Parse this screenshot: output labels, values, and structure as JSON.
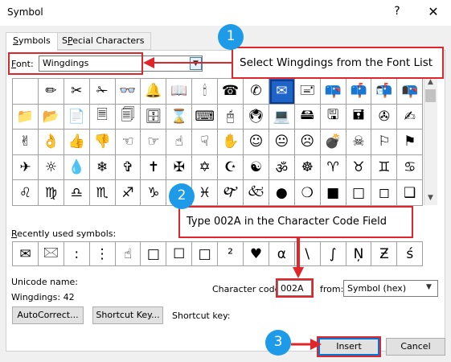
{
  "window": {
    "title": "Symbol",
    "help": "?",
    "close": "✕"
  },
  "tabs": [
    {
      "label": "Symbols",
      "mnemonic": "S",
      "rest": "ymbols"
    },
    {
      "label": "Special Characters",
      "mnemonic": "P",
      "pre": "S",
      "rest": "ecial Characters"
    }
  ],
  "font": {
    "label": "Font:",
    "mnemonic": "F",
    "rest": "ont:",
    "value": "Wingdings"
  },
  "grid": {
    "rows": [
      [
        "",
        "✏",
        "✂",
        "✁",
        "👓",
        "🔔",
        "📖",
        "🕯",
        "☎",
        "✆",
        "✉",
        "🖃",
        "📪",
        "📫",
        "📬",
        "📭"
      ],
      [
        "📁",
        "📂",
        "📄",
        "🗏",
        "🗐",
        "🗄",
        "⌛",
        "⌨",
        "🖰",
        "🖲",
        "💻",
        "🖴",
        "🖫",
        "🖬",
        "✇",
        "✍"
      ],
      [
        "✌",
        "👌",
        "👍",
        "👎",
        "☜",
        "☞",
        "☝",
        "☟",
        "✋",
        "☺",
        "😐",
        "☹",
        "💣",
        "☠",
        "⚐",
        "⚑"
      ],
      [
        "✈",
        "☼",
        "💧",
        "❄",
        "✞",
        "✝",
        "✠",
        "✡",
        "☪",
        "☯",
        "ॐ",
        "☸",
        "♈",
        "♉",
        "♊",
        "♋"
      ],
      [
        "♌",
        "♍",
        "♎",
        "♏",
        "♐",
        "♑",
        "♒",
        "♓",
        "🙰",
        "🙵",
        "●",
        "❍",
        "■",
        "□",
        "◻",
        "❑"
      ]
    ]
  },
  "recent": {
    "label": "Recently used symbols:",
    "mnemonic": "R",
    "rest": "ecently used symbols:",
    "symbols": [
      "✉",
      "🖂",
      ":",
      "⋮",
      "☝",
      "□",
      "☐",
      "□",
      "²",
      "♥",
      "α",
      "\\",
      "∫",
      "Ņ",
      "Ƶ",
      "ś"
    ]
  },
  "unicode": {
    "name_label": "Unicode name:",
    "value": "Wingdings: 42"
  },
  "char_code": {
    "label": "Character code:",
    "value": "002A",
    "from_label": "from:",
    "from_value": "Symbol (hex)"
  },
  "buttons": {
    "autocorrect": "AutoCorrect...",
    "shortcut_key": "Shortcut Key...",
    "insert": "Insert",
    "cancel": "Cancel"
  },
  "shortcut_label": "Shortcut key:",
  "annotations": {
    "step1_num": "1",
    "step1_text": "Select Wingdings from the Font List",
    "step2_num": "2",
    "step2_text": "Type 002A in the Character Code Field",
    "step3_num": "3"
  },
  "colors": {
    "annotation_red": "#e0262b",
    "badge_blue": "#1e9be8",
    "selection_blue": "#1e64c8"
  }
}
